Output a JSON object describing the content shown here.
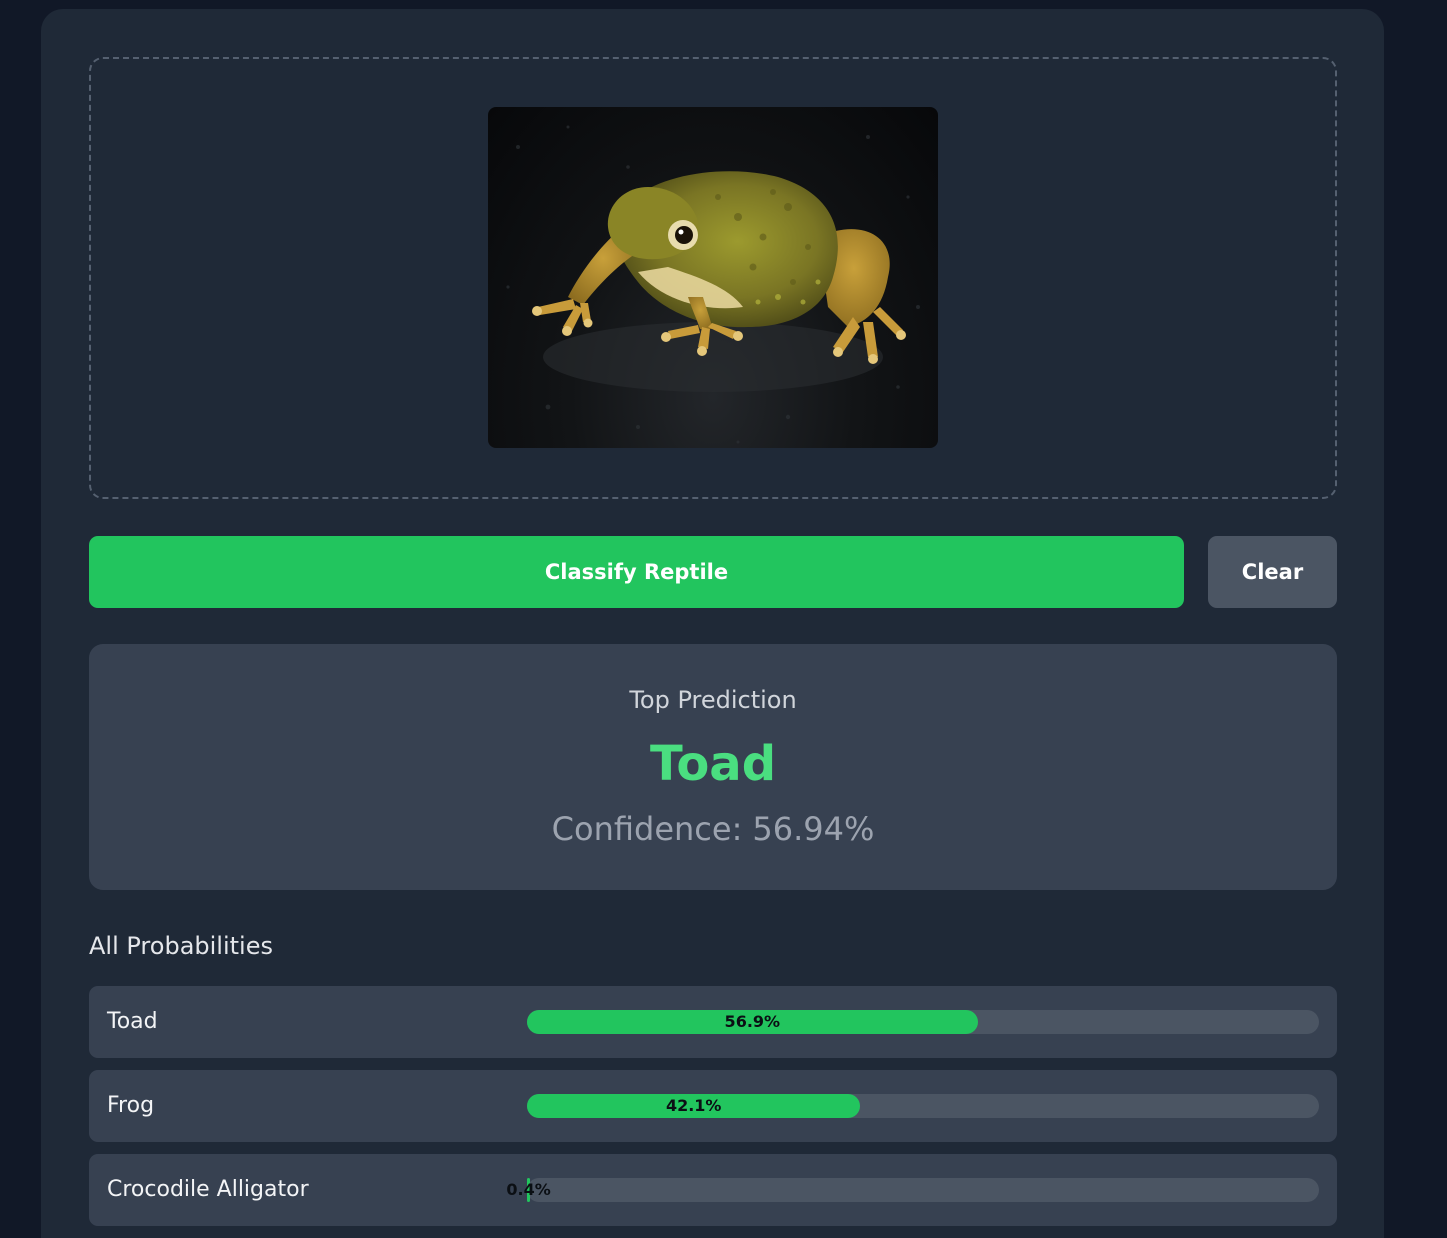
{
  "upload": {
    "preview_alt": "frog photo"
  },
  "actions": {
    "classify_label": "Classify Reptile",
    "clear_label": "Clear"
  },
  "prediction": {
    "label": "Top Prediction",
    "class_name": "Toad",
    "confidence_prefix": "Confidence:",
    "confidence_value": "56.94%"
  },
  "probabilities": {
    "title": "All Probabilities",
    "items": [
      {
        "name": "Toad",
        "percent_label": "56.9%",
        "value": 56.9
      },
      {
        "name": "Frog",
        "percent_label": "42.1%",
        "value": 42.1
      },
      {
        "name": "Crocodile Alligator",
        "percent_label": "0.4%",
        "value": 0.4
      }
    ]
  },
  "colors": {
    "page_bg": "#111827",
    "card_bg": "#1f2937",
    "panel_bg": "#374151",
    "accent_green": "#22c55e",
    "prediction_green": "#4ade80",
    "track": "#4b5563"
  }
}
